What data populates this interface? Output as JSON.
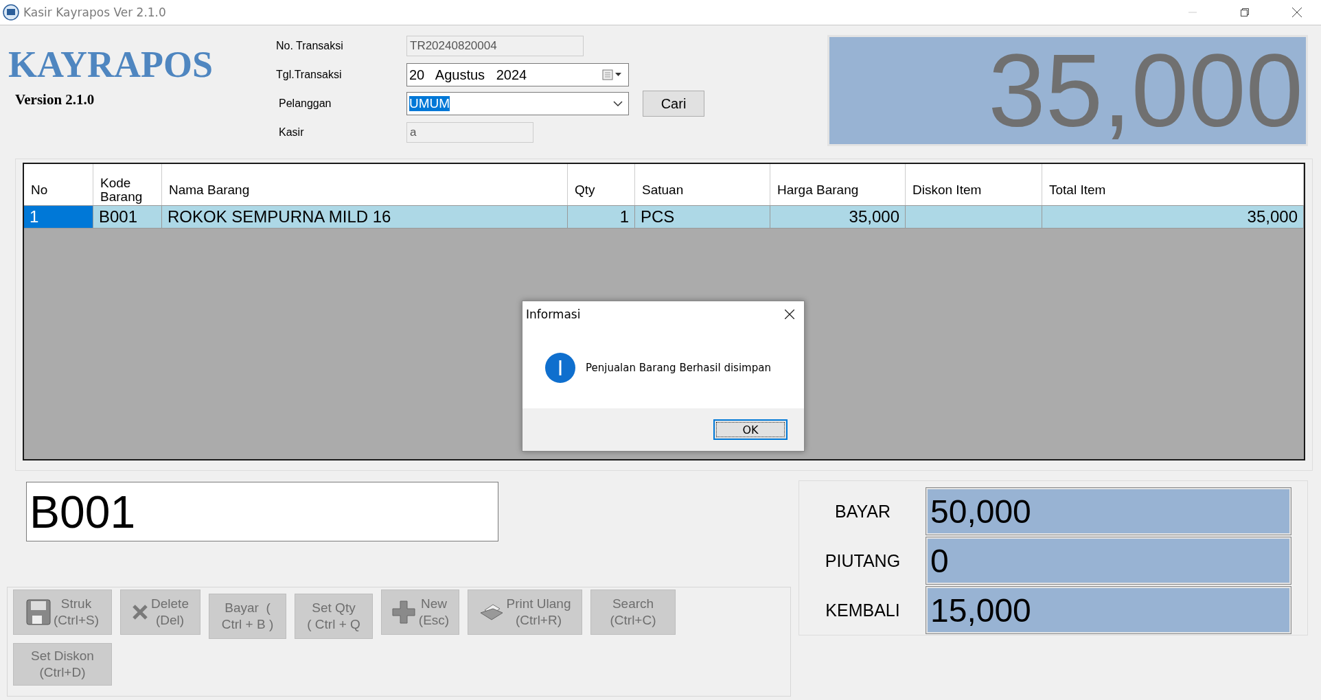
{
  "window": {
    "title": "Kasir Kayrapos Ver 2.1.0"
  },
  "brand": {
    "name": "KAYRAPOS",
    "version": "Version 2.1.0"
  },
  "form": {
    "fields": [
      {
        "label": "No. Transaksi",
        "value": "TR20240820004",
        "kind": "readonly"
      },
      {
        "label": "Tgl.Transaksi",
        "value": "20   Agustus   2024",
        "kind": "date"
      },
      {
        "label": "Pelanggan",
        "value": "UMUM",
        "kind": "combo",
        "selected": true
      },
      {
        "label": "Kasir",
        "value": "a",
        "kind": "readonly"
      }
    ],
    "search_button": "Cari"
  },
  "total_display": "35,000",
  "table": {
    "columns": [
      {
        "label": "No",
        "kind": "text"
      },
      {
        "label": "Kode Barang",
        "kind": "text"
      },
      {
        "label": "Nama Barang",
        "kind": "text"
      },
      {
        "label": "Qty",
        "kind": "number"
      },
      {
        "label": "Satuan",
        "kind": "text"
      },
      {
        "label": "Harga Barang",
        "kind": "number"
      },
      {
        "label": "Diskon Item",
        "kind": "number"
      },
      {
        "label": "Total Item",
        "kind": "number"
      }
    ],
    "rows": [
      {
        "selected": true,
        "cells": [
          "1",
          "B001",
          "ROKOK SEMPURNA MILD 16",
          "1",
          "PCS",
          "35,000",
          "",
          "35,000"
        ]
      }
    ]
  },
  "barcode_input": {
    "value": "B001"
  },
  "actions": [
    {
      "kind": "save",
      "lines": [
        "Struk",
        "(Ctrl+S)"
      ],
      "disabled": true
    },
    {
      "kind": "delete",
      "lines": [
        "Delete",
        "(Del)"
      ],
      "disabled": true
    },
    {
      "kind": "plain",
      "lines": [
        "Bayar  (",
        "Ctrl + B )"
      ],
      "disabled": true
    },
    {
      "kind": "plain",
      "lines": [
        "Set Qty",
        "( Ctrl + Q"
      ],
      "disabled": true
    },
    {
      "kind": "plus",
      "lines": [
        "New",
        "(Esc)"
      ],
      "disabled": true
    },
    {
      "kind": "print",
      "lines": [
        "Print Ulang",
        "(Ctrl+R)"
      ],
      "disabled": true
    },
    {
      "kind": "plain",
      "lines": [
        "Search",
        "(Ctrl+C)"
      ],
      "disabled": true
    },
    {
      "kind": "plain",
      "lines": [
        "Set Diskon",
        "(Ctrl+D)"
      ],
      "disabled": true
    }
  ],
  "payment": [
    {
      "label": "BAYAR",
      "value": "50,000"
    },
    {
      "label": "PIUTANG",
      "value": "0"
    },
    {
      "label": "KEMBALI",
      "value": "15,000"
    }
  ],
  "dialog": {
    "title": "Informasi",
    "message": "Penjualan Barang Berhasil disimpan",
    "button": "OK"
  }
}
